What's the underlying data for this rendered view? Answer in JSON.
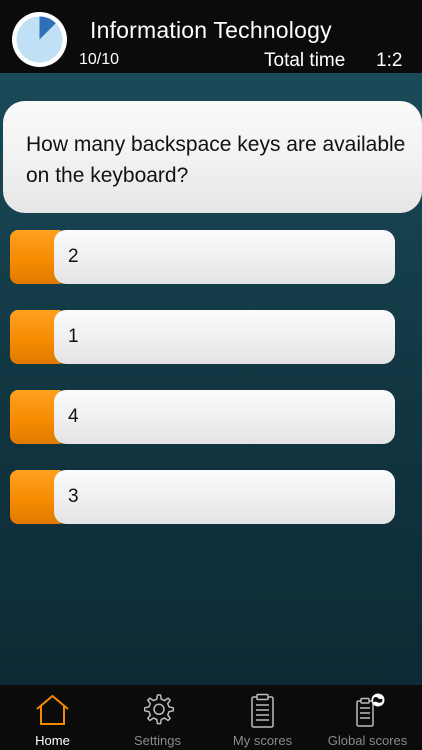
{
  "header": {
    "title": "Information Technology",
    "progress": "10/10",
    "total_time_label": "Total time",
    "total_time_value": "1:2",
    "timer_fraction": 0.125
  },
  "question": {
    "text": "How many backspace keys are available on the keyboard?"
  },
  "answers": [
    {
      "label": "2"
    },
    {
      "label": "1"
    },
    {
      "label": "4"
    },
    {
      "label": "3"
    }
  ],
  "tabbar": {
    "items": [
      {
        "label": "Home",
        "icon": "home-icon",
        "active": true
      },
      {
        "label": "Settings",
        "icon": "gear-icon",
        "active": false
      },
      {
        "label": "My scores",
        "icon": "clipboard-icon",
        "active": false
      },
      {
        "label": "Global scores",
        "icon": "global-scores-icon",
        "active": false
      }
    ]
  },
  "colors": {
    "accent": "#f58a00",
    "timer_fill": "#2f6fb6",
    "timer_bg": "#bfe0f5"
  }
}
